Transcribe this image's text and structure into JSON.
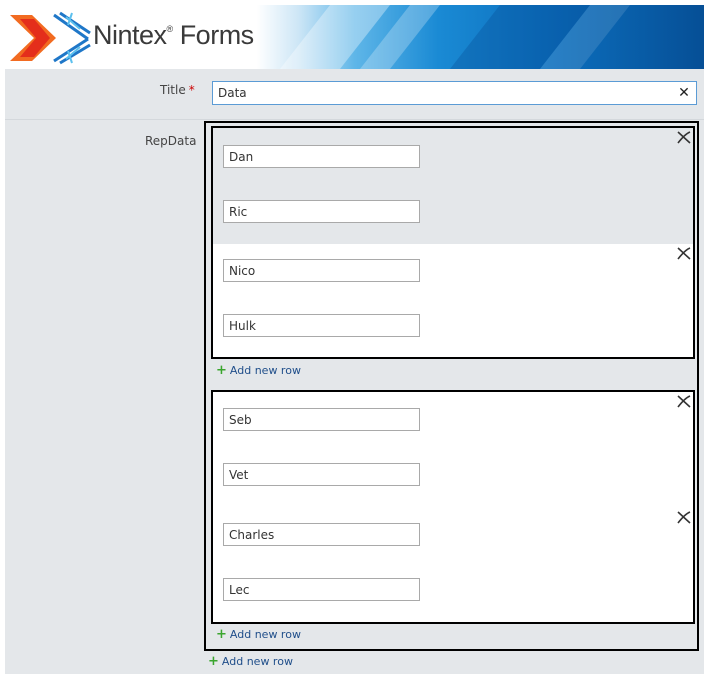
{
  "header": {
    "brand": "Nintex",
    "brand_suffix": "Forms",
    "trademark": "®"
  },
  "title_field": {
    "label": "Title",
    "required_marker": "*",
    "value": "Data",
    "clear_symbol": "✕"
  },
  "repdata": {
    "label": "RepData",
    "groups": [
      {
        "rows": [
          {
            "fields": [
              "Dan",
              "Ric"
            ]
          },
          {
            "fields": [
              "Nico",
              "Hulk"
            ]
          }
        ],
        "add_row_label": "Add new row"
      },
      {
        "rows": [
          {
            "fields": [
              "Seb",
              "Vet"
            ]
          },
          {
            "fields": [
              "Charles",
              "Lec"
            ]
          }
        ],
        "add_row_label": "Add new row"
      }
    ],
    "add_row_label": "Add new row"
  },
  "colors": {
    "accent": "#5b9bd5",
    "link": "#1f4e8a",
    "plus": "#3aa52e",
    "required": "#cc0000",
    "form_bg": "#e4e7ea"
  },
  "icons": {
    "delete": "delete-row-icon",
    "add": "plus-icon",
    "clear": "clear-icon"
  }
}
